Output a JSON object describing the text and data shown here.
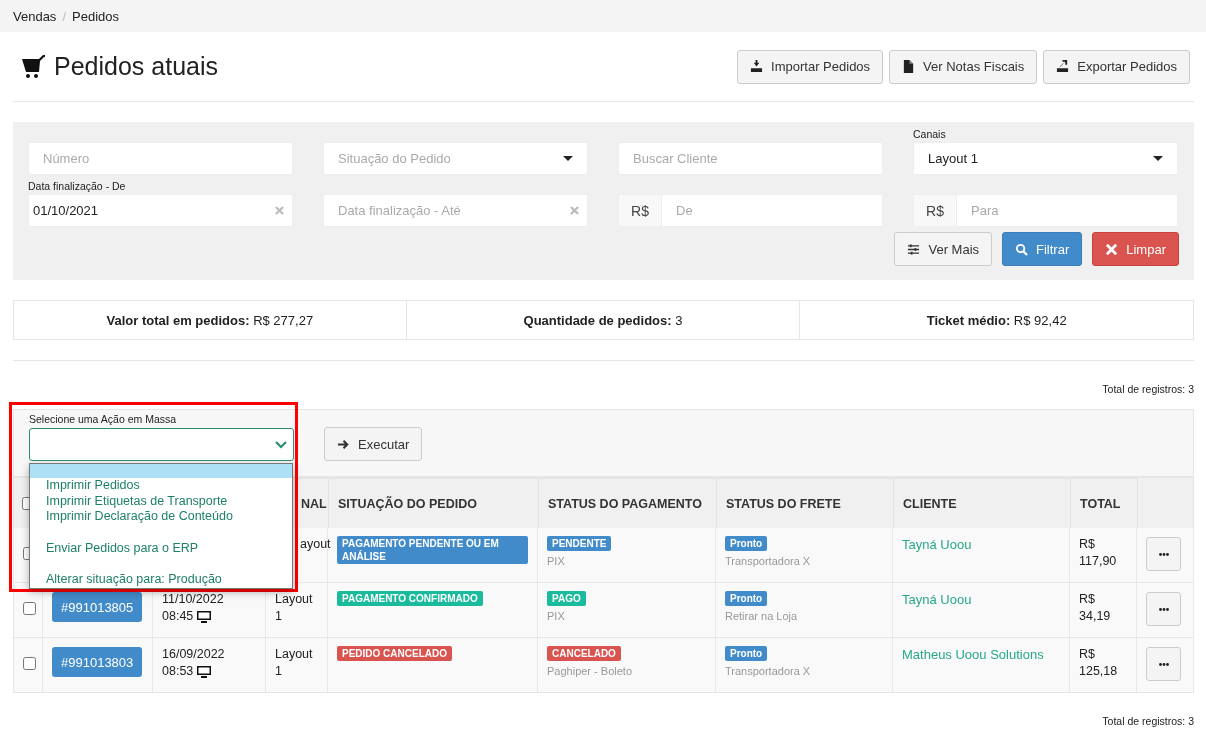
{
  "breadcrumb": {
    "items": [
      "Vendas",
      "Pedidos"
    ],
    "separator": "/"
  },
  "page_title": "Pedidos atuais",
  "header_buttons": [
    {
      "label": "Importar Pedidos"
    },
    {
      "label": "Ver Notas Fiscais"
    },
    {
      "label": "Exportar Pedidos"
    }
  ],
  "filters": [
    {
      "kind": "text",
      "placeholder": "Número"
    },
    {
      "kind": "select",
      "placeholder": "Situação do Pedido"
    },
    {
      "kind": "text",
      "placeholder": "Buscar Cliente"
    },
    {
      "kind": "select",
      "label": "Canais",
      "value": "Layout 1"
    },
    {
      "kind": "date",
      "label": "Data finalização - De",
      "value": "01/10/2021"
    },
    {
      "kind": "date",
      "placeholder": "Data finalização - Até"
    },
    {
      "kind": "money",
      "prefix": "R$",
      "placeholder": "De"
    },
    {
      "kind": "money",
      "prefix": "R$",
      "placeholder": "Para"
    }
  ],
  "filter_buttons": [
    {
      "kind": "default",
      "label": "Ver Mais"
    },
    {
      "kind": "primary",
      "label": "Filtrar"
    },
    {
      "kind": "danger",
      "label": "Limpar"
    }
  ],
  "summary": [
    "**Valor total em pedidos:** R$ 277,27",
    "**Quantidade de pedidos:** 3",
    "**Ticket médio:** R$ 92,42"
  ],
  "total_records_top": "Total de registros: 3",
  "mass_action": {
    "label": "Selecione uma Ação em Massa",
    "highlighted": true,
    "menu_open": true,
    "blank_option_highlighted": true,
    "option_groups": [
      [
        "Imprimir Pedidos",
        "Imprimir Etiquetas de Transporte",
        "Imprimir Declaração de Conteúdo"
      ],
      [
        "Enviar Pedidos para o ERP"
      ],
      [
        "Alterar situação para: Produção"
      ]
    ],
    "execute_button": "Executar"
  },
  "table": {
    "columns": [
      {},
      {},
      {},
      {
        "label": "NAL"
      },
      {
        "label": "SITUAÇÃO DO PEDIDO"
      },
      {
        "label": "STATUS DO PAGAMENTO"
      },
      {
        "label": "STATUS DO FRETE"
      },
      {
        "label": "CLIENTE"
      },
      {
        "label": "TOTAL"
      },
      {}
    ],
    "header_checked": false,
    "rows": [
      {
        "checked": false,
        "canal": "ayout",
        "situacao": {
          "text": "PAGAMENTO PENDENTE OU EM ANÁLISE",
          "color": "#428bca"
        },
        "pagamento": {
          "text": "PENDENTE",
          "color": "#428bca",
          "detail": "PIX"
        },
        "frete": {
          "text": "Pronto",
          "color": "#428bca",
          "detail": "Transportadora X"
        },
        "cliente": "Tayná Uoou",
        "total": "R$ 117,90"
      },
      {
        "checked": false,
        "order": "#991013805",
        "date": "11/10/2022",
        "time": "08:45",
        "canal": "Layout 1",
        "situacao": {
          "text": "PAGAMENTO CONFIRMADO",
          "color": "#1abb9c"
        },
        "pagamento": {
          "text": "PAGO",
          "color": "#1abb9c",
          "detail": "PIX"
        },
        "frete": {
          "text": "Pronto",
          "color": "#428bca",
          "detail": "Retirar na Loja"
        },
        "cliente": "Tayná Uoou",
        "total": "R$ 34,19"
      },
      {
        "checked": false,
        "order": "#991013803",
        "date": "16/09/2022",
        "time": "08:53",
        "canal": "Layout 1",
        "situacao": {
          "text": "PEDIDO CANCELADO",
          "color": "#d9534f"
        },
        "pagamento": {
          "text": "CANCELADO",
          "color": "#d9534f",
          "detail": "Paghiper - Boleto"
        },
        "frete": {
          "text": "Pronto",
          "color": "#428bca",
          "detail": "Transportadora X"
        },
        "cliente": "Matheus Uoou Solutions",
        "total": "R$ 125,18"
      }
    ]
  },
  "total_records_bottom": "Total de registros: 3"
}
